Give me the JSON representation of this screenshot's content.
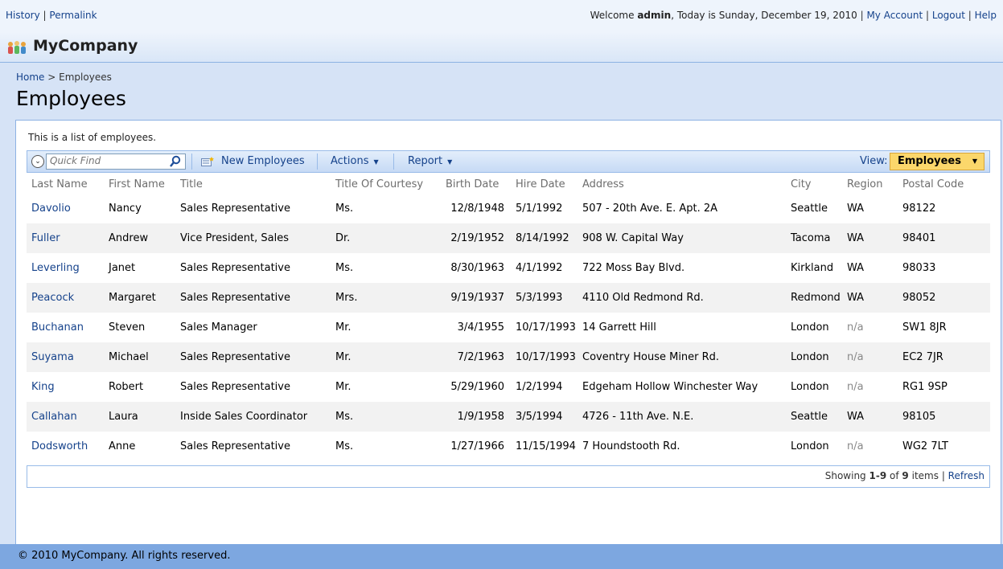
{
  "topbar": {
    "history": "History",
    "permalink": "Permalink",
    "welcome_prefix": "Welcome",
    "user": "admin",
    "date_text": ", Today is Sunday, December 19, 2010",
    "my_account": "My Account",
    "logout": "Logout",
    "help": "Help"
  },
  "brand": {
    "name": "MyCompany",
    "logo_icon": "people-group-icon"
  },
  "breadcrumb": {
    "home": "Home",
    "separator": ">",
    "current": "Employees"
  },
  "page_title": "Employees",
  "description": "This is a list of employees.",
  "toolbar": {
    "quick_find_placeholder": "Quick Find",
    "new_label": "New Employees",
    "actions_label": "Actions",
    "report_label": "Report",
    "view_label": "View:",
    "view_value": "Employees"
  },
  "table": {
    "columns": [
      "Last Name",
      "First Name",
      "Title",
      "Title Of Courtesy",
      "Birth Date",
      "Hire Date",
      "Address",
      "City",
      "Region",
      "Postal Code"
    ],
    "rows": [
      [
        "Davolio",
        "Nancy",
        "Sales Representative",
        "Ms.",
        "12/8/1948",
        "5/1/1992",
        "507 - 20th Ave. E. Apt. 2A",
        "Seattle",
        "WA",
        "98122"
      ],
      [
        "Fuller",
        "Andrew",
        "Vice President, Sales",
        "Dr.",
        "2/19/1952",
        "8/14/1992",
        "908 W. Capital Way",
        "Tacoma",
        "WA",
        "98401"
      ],
      [
        "Leverling",
        "Janet",
        "Sales Representative",
        "Ms.",
        "8/30/1963",
        "4/1/1992",
        "722 Moss Bay Blvd.",
        "Kirkland",
        "WA",
        "98033"
      ],
      [
        "Peacock",
        "Margaret",
        "Sales Representative",
        "Mrs.",
        "9/19/1937",
        "5/3/1993",
        "4110 Old Redmond Rd.",
        "Redmond",
        "WA",
        "98052"
      ],
      [
        "Buchanan",
        "Steven",
        "Sales Manager",
        "Mr.",
        "3/4/1955",
        "10/17/1993",
        "14 Garrett Hill",
        "London",
        "n/a",
        "SW1 8JR"
      ],
      [
        "Suyama",
        "Michael",
        "Sales Representative",
        "Mr.",
        "7/2/1963",
        "10/17/1993",
        "Coventry House Miner Rd.",
        "London",
        "n/a",
        "EC2 7JR"
      ],
      [
        "King",
        "Robert",
        "Sales Representative",
        "Mr.",
        "5/29/1960",
        "1/2/1994",
        "Edgeham Hollow Winchester Way",
        "London",
        "n/a",
        "RG1 9SP"
      ],
      [
        "Callahan",
        "Laura",
        "Inside Sales Coordinator",
        "Ms.",
        "1/9/1958",
        "3/5/1994",
        "4726 - 11th Ave. N.E.",
        "Seattle",
        "WA",
        "98105"
      ],
      [
        "Dodsworth",
        "Anne",
        "Sales Representative",
        "Ms.",
        "1/27/1966",
        "11/15/1994",
        "7 Houndstooth Rd.",
        "London",
        "n/a",
        "WG2 7LT"
      ]
    ]
  },
  "paging": {
    "showing": "Showing",
    "range": "1-9",
    "of": "of",
    "total": "9",
    "items": "items",
    "refresh": "Refresh"
  },
  "footer": {
    "copyright": "© 2010 MyCompany. All rights reserved."
  },
  "colors": {
    "link": "#15428b",
    "page_bg": "#d6e3f6",
    "view_highlight": "#fbd76b",
    "footer_bg": "#7da7e0"
  }
}
